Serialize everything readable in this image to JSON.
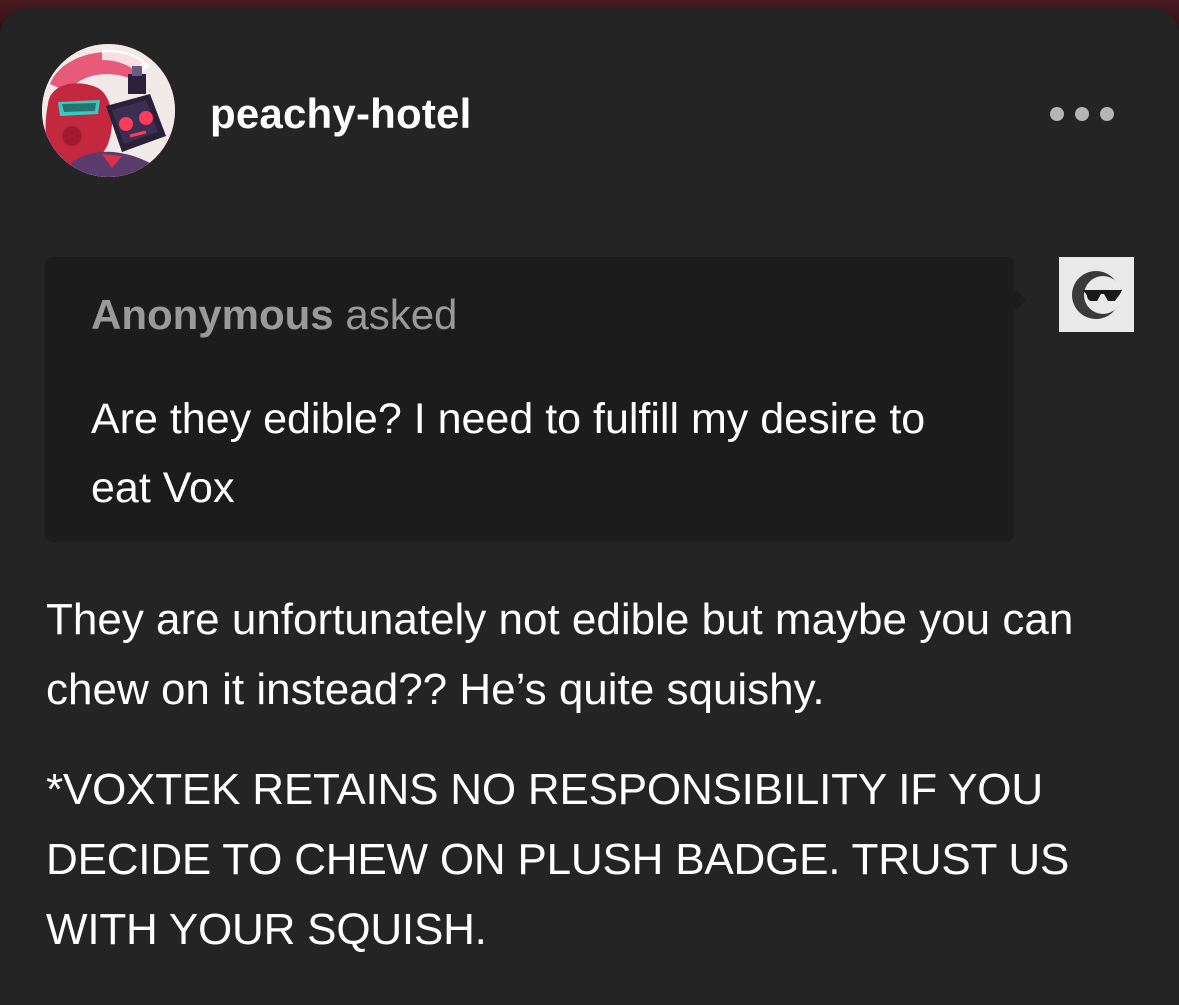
{
  "post": {
    "blog_name": "peachy-hotel",
    "ask": {
      "asker": "Anonymous",
      "asked_label": "asked",
      "question": "Are they edible? I need to fulfill my desire to eat Vox"
    },
    "answer": {
      "paragraph_1": "They are unfortunately not edible but maybe you can chew on it instead?? He’s quite squishy.",
      "paragraph_2": "*VOXTEK RETAINS NO RESPONSIBILITY IF YOU DECIDE TO CHEW ON PLUSH BADGE. TRUST US WITH YOUR SQUISH."
    }
  },
  "icons": {
    "more": "ellipsis-icon",
    "anon_avatar": "sunglasses-face-icon",
    "blog_avatar": "character-avatar"
  },
  "colors": {
    "card_background": "#242424",
    "ask_background": "#1c1c1c",
    "muted_text": "#9a9a9a",
    "text": "#ffffff"
  }
}
